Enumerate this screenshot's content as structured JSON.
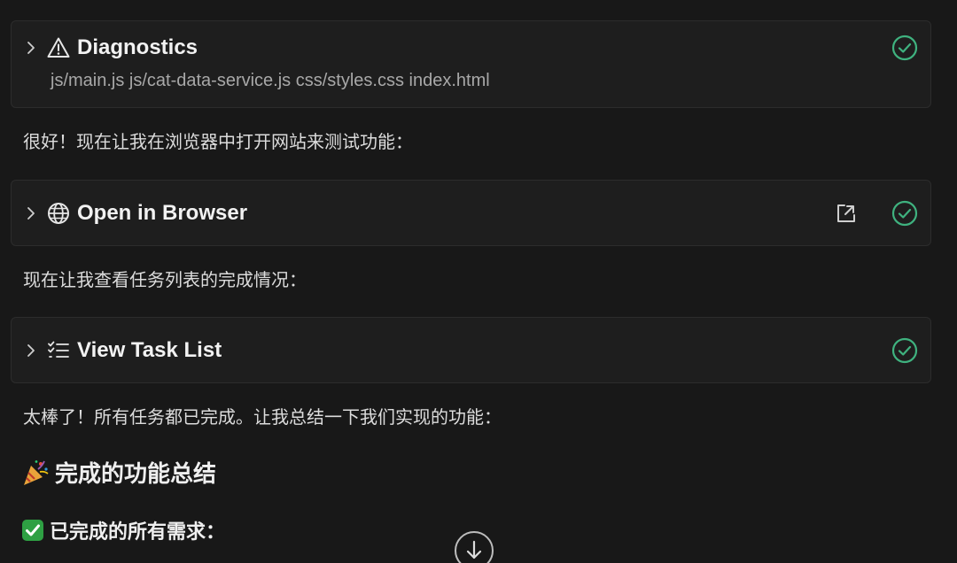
{
  "tools": [
    {
      "title": "Diagnostics",
      "icon": "warning-triangle-icon",
      "files": "js/main.js js/cat-data-service.js css/styles.css index.html",
      "status": "success"
    },
    {
      "title": "Open in Browser",
      "icon": "globe-icon",
      "status": "success"
    },
    {
      "title": "View Task List",
      "icon": "task-list-icon",
      "status": "success"
    }
  ],
  "messages": {
    "after_diagnostics": "很好！现在让我在浏览器中打开网站来测试功能：",
    "after_browser": "现在让我查看任务列表的完成情况：",
    "after_tasks": "太棒了！所有任务都已完成。让我总结一下我们实现的功能："
  },
  "summary": {
    "heading_emoji": "party-popper",
    "heading": "完成的功能总结",
    "subheading_emoji": "check-mark-button",
    "subheading": "已完成的所有需求："
  },
  "colors": {
    "background": "#181818",
    "card": "#1e1e1e",
    "success_green": "#3fb27f",
    "check_box_green": "#2ea043"
  }
}
